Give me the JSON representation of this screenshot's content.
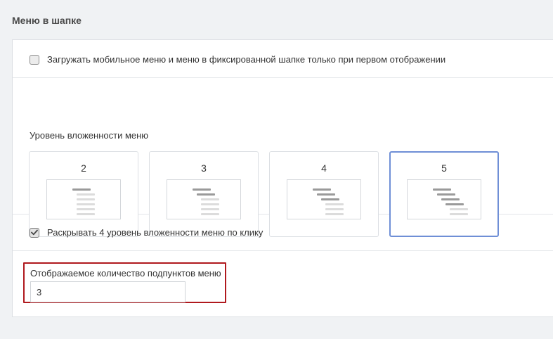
{
  "section": {
    "title": "Меню в шапке"
  },
  "load_once": {
    "label": "Загружать мобильное меню и меню в фиксированной шапке только при первом отображении",
    "checked": false
  },
  "nesting": {
    "label": "Уровень вложенности меню",
    "options": [
      {
        "value": "2",
        "levels": 2
      },
      {
        "value": "3",
        "levels": 3
      },
      {
        "value": "4",
        "levels": 4
      },
      {
        "value": "5",
        "levels": 5
      }
    ],
    "selected": "5"
  },
  "expand_on_click": {
    "label": "Раскрывать 4 уровень вложенности меню по клику",
    "checked": true
  },
  "subitems_count": {
    "label": "Отображаемое количество подпунктов меню",
    "value": "3"
  },
  "colors": {
    "highlight_border": "#b0191e",
    "selected_card_border": "#6f8fd6"
  }
}
